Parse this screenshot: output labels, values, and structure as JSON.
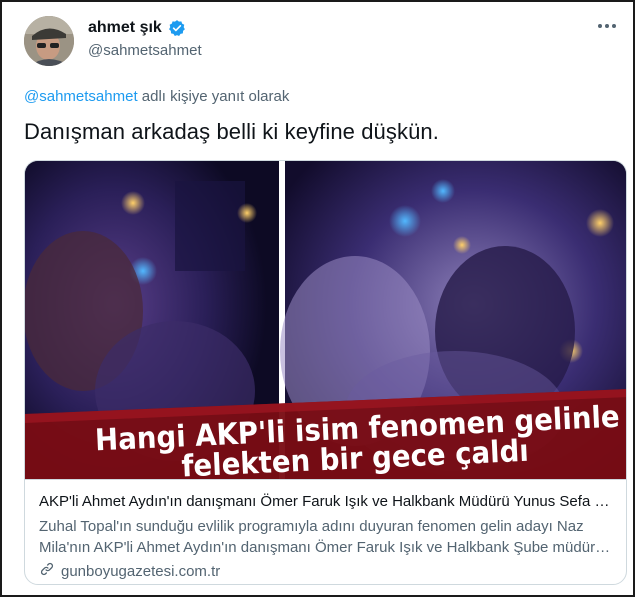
{
  "tweet": {
    "author_name": "ahmet şık",
    "author_handle": "@sahmetsahmet",
    "reply_mention": "@sahmetsahmet",
    "reply_suffix": " adlı kişiye yanıt olarak",
    "text": "Danışman arkadaş belli ki keyfine düşkün."
  },
  "link_card": {
    "image_headline_line1": "Hangi AKP'li isim fenomen gelinle",
    "image_headline_line2": "felekten bir gece çaldı",
    "title": "AKP'li Ahmet Aydın'ın danışmanı Ömer Faruk Işık ve Halkbank Müdürü Yunus Sefa Kurt...",
    "description": "Zuhal Topal'ın sunduğu evlilik programıyla adını duyuran fenomen gelin adayı Naz Mila'nın AKP'li Ahmet Aydın'ın danışmanı Ömer Faruk Işık ve Halkbank Şube müdürü ile eğlendiği görüntüler ortaya çıktı.",
    "domain": "gunboyugazetesi.com.tr"
  },
  "icons": {
    "verified": "verified-badge-icon",
    "more": "more-options-icon",
    "link": "link-icon"
  },
  "colors": {
    "accent": "#1d9bf0",
    "secondary_text": "#536471",
    "headline_banner": "#7a0d14"
  }
}
